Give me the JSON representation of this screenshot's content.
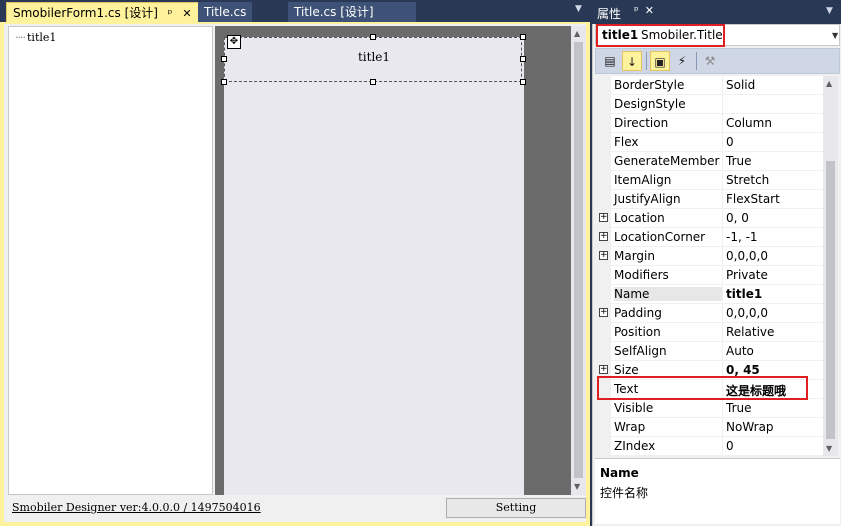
{
  "doc_tabs": [
    {
      "label": "SmobilerForm1.cs [设计]",
      "active": true
    },
    {
      "label": "Title.cs",
      "active": false
    },
    {
      "label": "Title.cs [设计]",
      "active": false
    }
  ],
  "tree": {
    "item": "title1"
  },
  "designer": {
    "control_text": "title1",
    "version_text": "Smobiler Designer ver:4.0.0.0 / 1497504016",
    "setting_label": "Setting"
  },
  "properties": {
    "header_title": "属性",
    "object_name": "title1",
    "object_type": "Smobiler.Title",
    "rows": [
      {
        "name": "BorderStyle",
        "value": "Solid",
        "expandable": false,
        "bold": false
      },
      {
        "name": "DesignStyle",
        "value": "",
        "expandable": false,
        "bold": false
      },
      {
        "name": "Direction",
        "value": "Column",
        "expandable": false,
        "bold": false
      },
      {
        "name": "Flex",
        "value": "0",
        "expandable": false,
        "bold": false
      },
      {
        "name": "GenerateMember",
        "value": "True",
        "expandable": false,
        "bold": false
      },
      {
        "name": "ItemAlign",
        "value": "Stretch",
        "expandable": false,
        "bold": false
      },
      {
        "name": "JustifyAlign",
        "value": "FlexStart",
        "expandable": false,
        "bold": false
      },
      {
        "name": "Location",
        "value": "0, 0",
        "expandable": true,
        "bold": false
      },
      {
        "name": "LocationCorner",
        "value": "-1, -1",
        "expandable": true,
        "bold": false
      },
      {
        "name": "Margin",
        "value": "0,0,0,0",
        "expandable": true,
        "bold": false
      },
      {
        "name": "Modifiers",
        "value": "Private",
        "expandable": false,
        "bold": false
      },
      {
        "name": "Name",
        "value": "title1",
        "expandable": false,
        "bold": true
      },
      {
        "name": "Padding",
        "value": "0,0,0,0",
        "expandable": true,
        "bold": false
      },
      {
        "name": "Position",
        "value": "Relative",
        "expandable": false,
        "bold": false
      },
      {
        "name": "SelfAlign",
        "value": "Auto",
        "expandable": false,
        "bold": false
      },
      {
        "name": "Size",
        "value": "0, 45",
        "expandable": true,
        "bold": true
      },
      {
        "name": "Text",
        "value": "这是标题哦",
        "expandable": false,
        "bold": true
      },
      {
        "name": "Visible",
        "value": "True",
        "expandable": false,
        "bold": false
      },
      {
        "name": "Wrap",
        "value": "NoWrap",
        "expandable": false,
        "bold": false
      },
      {
        "name": "ZIndex",
        "value": "0",
        "expandable": false,
        "bold": false
      }
    ],
    "description_title": "Name",
    "description_text": "控件名称"
  },
  "colors": {
    "chrome": "#293955",
    "active_tab": "#fff29d",
    "highlight_box": "#e02020"
  }
}
